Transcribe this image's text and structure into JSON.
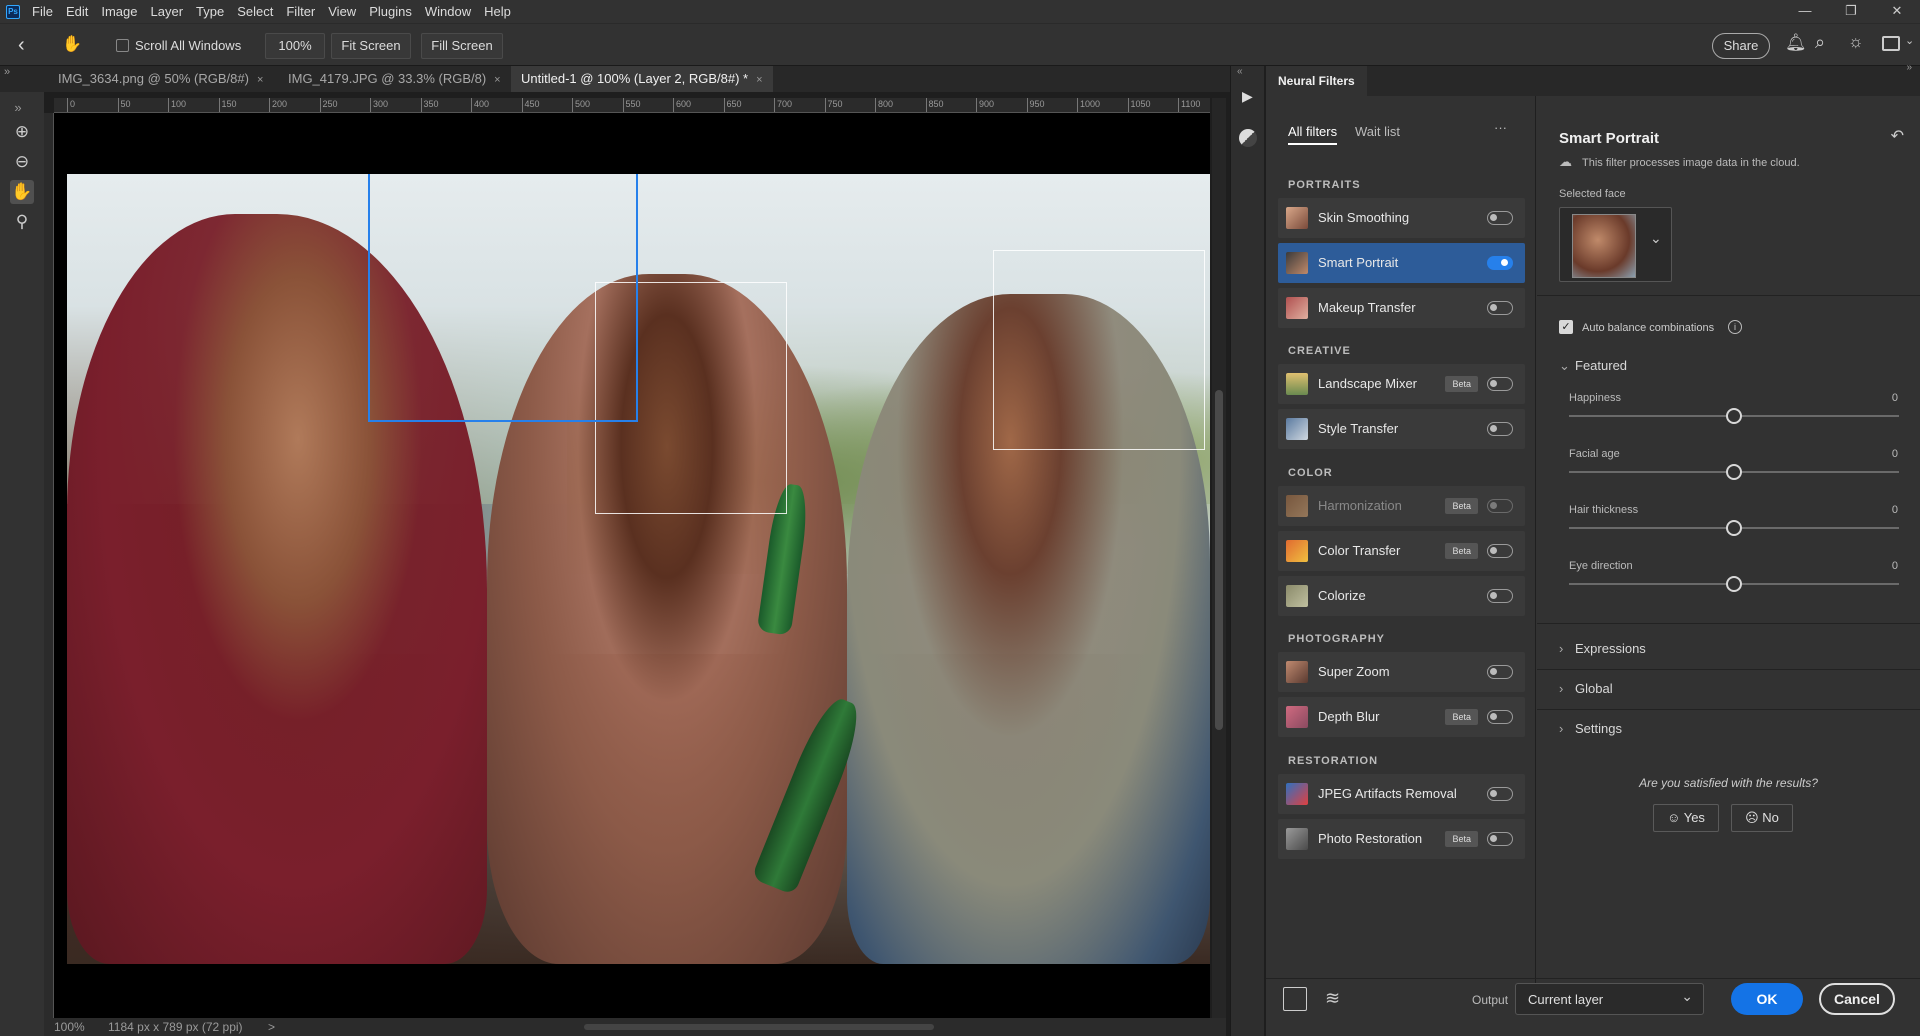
{
  "app": {
    "logo_text": "Ps"
  },
  "menu": [
    "File",
    "Edit",
    "Image",
    "Layer",
    "Type",
    "Select",
    "Filter",
    "View",
    "Plugins",
    "Window",
    "Help"
  ],
  "window_controls": {
    "minimize": "—",
    "restore": "❐",
    "close": "✕"
  },
  "options_bar": {
    "scroll_all_windows": "Scroll All Windows",
    "zoom_value": "100%",
    "fit_screen": "Fit Screen",
    "fill_screen": "Fill Screen",
    "share": "Share"
  },
  "tabs": [
    {
      "label": "IMG_3634.png @ 50% (RGB/8#)",
      "close": "×"
    },
    {
      "label": "IMG_4179.JPG @ 33.3% (RGB/8)",
      "close": "×"
    },
    {
      "label": "Untitled-1 @ 100% (Layer 2, RGB/8#) *",
      "close": "×"
    }
  ],
  "ruler_ticks": [
    "0",
    "50",
    "100",
    "150",
    "200",
    "250",
    "300",
    "350",
    "400",
    "450",
    "500",
    "550",
    "600",
    "650",
    "700",
    "750",
    "800",
    "850",
    "900",
    "950",
    "1000",
    "1050",
    "1100"
  ],
  "status": {
    "zoom": "100%",
    "doc_info": "1184 px x 789 px (72 ppi)",
    "arrow": ">"
  },
  "panel": {
    "title": "Neural Filters"
  },
  "filter_tabs": {
    "all": "All filters",
    "wait": "Wait list",
    "more": "···"
  },
  "sections": {
    "portraits": "PORTRAITS",
    "creative": "CREATIVE",
    "color": "COLOR",
    "photography": "PHOTOGRAPHY",
    "restoration": "RESTORATION"
  },
  "filters": {
    "skin_smoothing": {
      "name": "Skin Smoothing",
      "on": false
    },
    "smart_portrait": {
      "name": "Smart Portrait",
      "on": true
    },
    "makeup_transfer": {
      "name": "Makeup Transfer",
      "on": false
    },
    "landscape_mixer": {
      "name": "Landscape Mixer",
      "beta": "Beta",
      "on": false
    },
    "style_transfer": {
      "name": "Style Transfer",
      "on": false
    },
    "harmonization": {
      "name": "Harmonization",
      "beta": "Beta",
      "on": false
    },
    "color_transfer": {
      "name": "Color Transfer",
      "beta": "Beta",
      "on": false
    },
    "colorize": {
      "name": "Colorize",
      "on": false
    },
    "super_zoom": {
      "name": "Super Zoom",
      "on": false
    },
    "depth_blur": {
      "name": "Depth Blur",
      "beta": "Beta",
      "on": false
    },
    "jpeg_artifacts": {
      "name": "JPEG Artifacts Removal",
      "on": false
    },
    "photo_restoration": {
      "name": "Photo Restoration",
      "beta": "Beta",
      "on": false
    }
  },
  "settings": {
    "title": "Smart Portrait",
    "cloud_note": "This filter processes image data in the cloud.",
    "selected_face": "Selected face",
    "auto_balance": "Auto balance combinations",
    "featured": "Featured",
    "sliders": [
      {
        "label": "Happiness",
        "value": "0"
      },
      {
        "label": "Facial age",
        "value": "0"
      },
      {
        "label": "Hair thickness",
        "value": "0"
      },
      {
        "label": "Eye direction",
        "value": "0"
      }
    ],
    "expressions": "Expressions",
    "global": "Global",
    "settings": "Settings",
    "feedback_question": "Are you satisfied with the results?",
    "yes": "Yes",
    "no": "No"
  },
  "footer": {
    "output_label": "Output",
    "output_value": "Current layer",
    "ok": "OK",
    "cancel": "Cancel"
  },
  "colors": {
    "accent": "#2680eb",
    "ok_button": "#1473e6",
    "panel_bg": "#323232"
  }
}
